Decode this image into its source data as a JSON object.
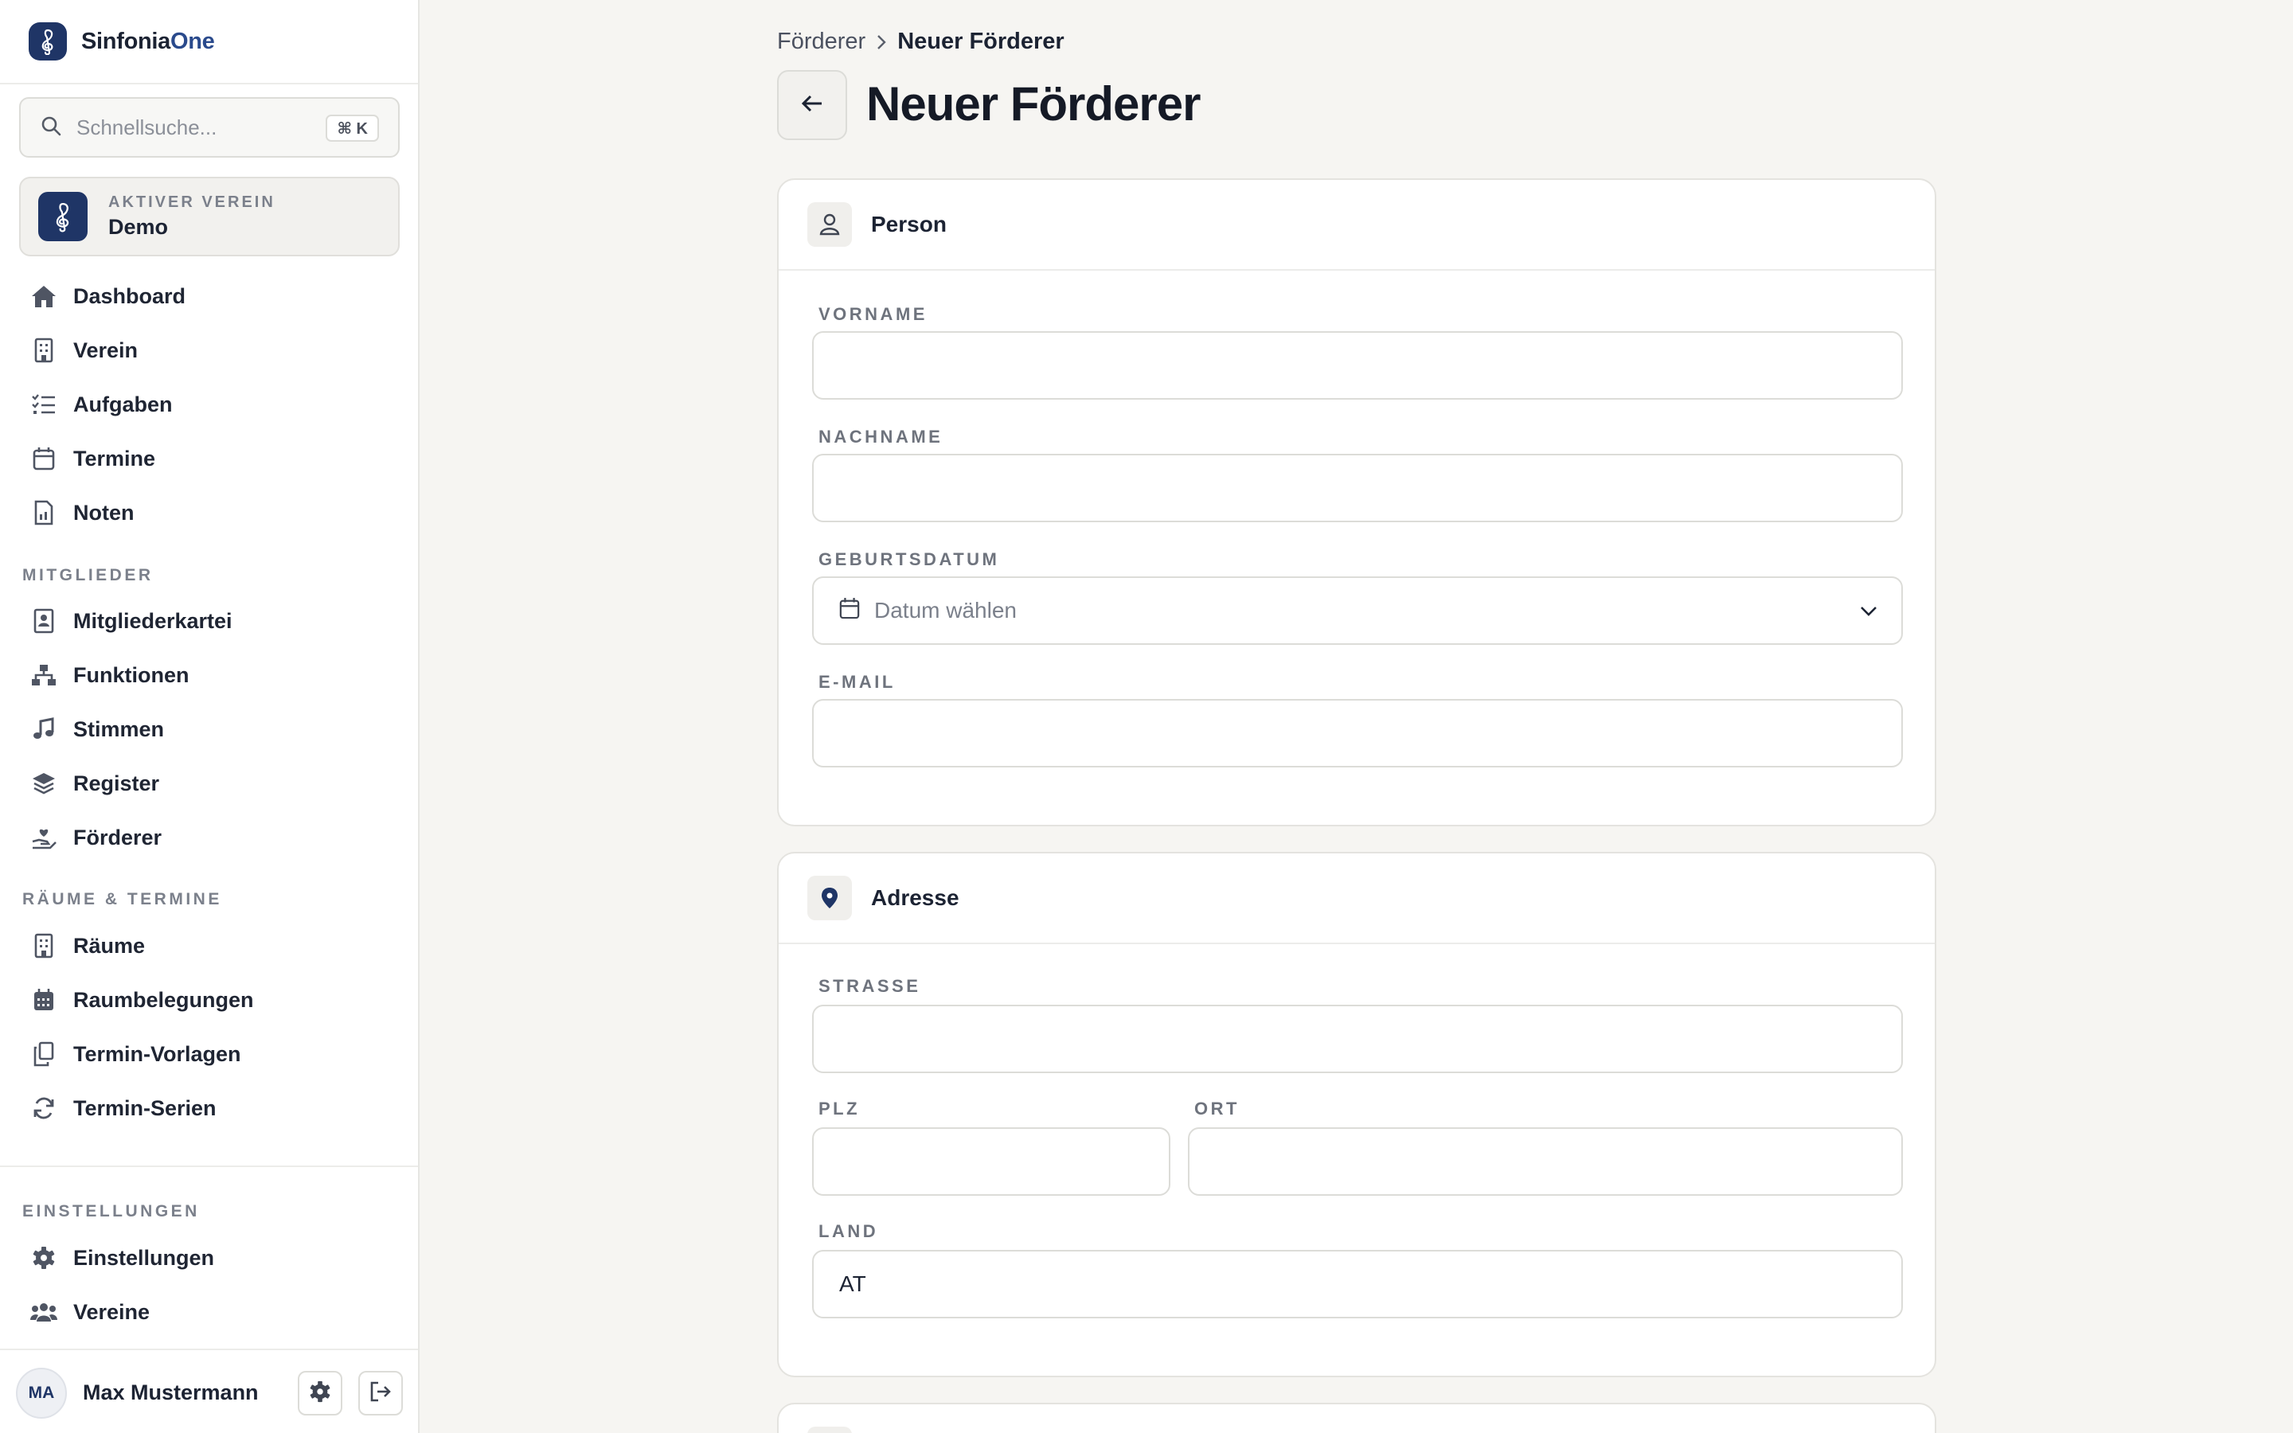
{
  "app": {
    "brand_first": "Sinfonia",
    "brand_second": "One"
  },
  "search": {
    "placeholder": "Schnellsuche...",
    "shortcut": "⌘ K"
  },
  "active_club": {
    "caption": "AKTIVER VEREIN",
    "name": "Demo"
  },
  "nav": {
    "main": [
      {
        "label": "Dashboard",
        "icon": "home-icon"
      },
      {
        "label": "Verein",
        "icon": "building-icon"
      },
      {
        "label": "Aufgaben",
        "icon": "list-check-icon"
      },
      {
        "label": "Termine",
        "icon": "calendar-icon"
      },
      {
        "label": "Noten",
        "icon": "music-sheet-icon"
      }
    ],
    "members_section": "MITGLIEDER",
    "members": [
      {
        "label": "Mitgliederkartei",
        "icon": "contact-card-icon"
      },
      {
        "label": "Funktionen",
        "icon": "hierarchy-icon"
      },
      {
        "label": "Stimmen",
        "icon": "music-note-icon"
      },
      {
        "label": "Register",
        "icon": "layers-icon"
      },
      {
        "label": "Förderer",
        "icon": "hand-heart-icon"
      }
    ],
    "rooms_section": "RÄUME & TERMINE",
    "rooms": [
      {
        "label": "Räume",
        "icon": "building-icon"
      },
      {
        "label": "Raumbelegungen",
        "icon": "calendar-grid-icon"
      },
      {
        "label": "Termin-Vorlagen",
        "icon": "copy-icon"
      },
      {
        "label": "Termin-Serien",
        "icon": "refresh-icon"
      }
    ],
    "settings_section": "EINSTELLUNGEN",
    "settings": [
      {
        "label": "Einstellungen",
        "icon": "gear-icon"
      },
      {
        "label": "Vereine",
        "icon": "users-icon"
      }
    ]
  },
  "user": {
    "initials": "MA",
    "name": "Max Mustermann"
  },
  "breadcrumb": {
    "parent": "Förderer",
    "current": "Neuer Förderer"
  },
  "page": {
    "title": "Neuer Förderer"
  },
  "person_card": {
    "title": "Person",
    "first_name_label": "VORNAME",
    "first_name_value": "",
    "last_name_label": "NACHNAME",
    "last_name_value": "",
    "birthdate_label": "GEBURTSDATUM",
    "birthdate_placeholder": "Datum wählen",
    "email_label": "E-MAIL",
    "email_value": ""
  },
  "address_card": {
    "title": "Adresse",
    "street_label": "STRASSE",
    "street_value": "",
    "zip_label": "PLZ",
    "zip_value": "",
    "city_label": "ORT",
    "city_value": "",
    "country_label": "LAND",
    "country_value": "AT"
  },
  "colors": {
    "brand": "#1f3566",
    "background": "#f6f5f2",
    "text": "#1c2333"
  }
}
